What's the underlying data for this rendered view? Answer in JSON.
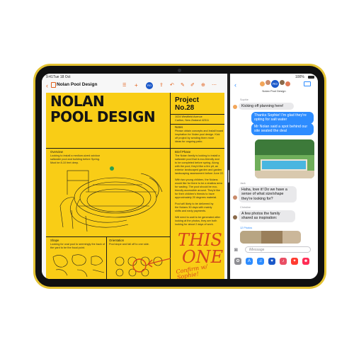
{
  "left_status": {
    "time": "9:41",
    "date": "Tue 18 Oct"
  },
  "right_status": {
    "battery": "100%"
  },
  "pages": {
    "doc_title": "Nolan Pool Design",
    "back_icon": "chevron-left-icon",
    "toolbar_icons": [
      "list-icon",
      "add-icon",
      "collaborate-icon",
      "share-icon",
      "undo-icon",
      "format-brush-icon",
      "more-icon"
    ]
  },
  "poster": {
    "title_lines": [
      "NOLAN",
      "POOL DESIGN"
    ],
    "project_lines": [
      "Project",
      "No.28"
    ],
    "address_lines": [
      "1024 Westfield Avenue",
      "Carlton, New Zealand 42311"
    ],
    "notes_label": "Notes",
    "notes_text": [
      "Please obtain concepts and install board",
      "inspiration for Nolan pool design. Kick",
      "off project by sending them more",
      "ideas for ongoing patio."
    ],
    "overview_label": "Overview",
    "overview_text": [
      "Looking to install a medium-sized outdoor",
      "saltwater pool and building before Spring.",
      "Must be 8-10 feet deep."
    ],
    "brief_label": "Brief Phase",
    "brief_text": [
      "The Nolan family is looking to install a",
      "saltwater pool that is eco-friendly and",
      "to be completed before spring. Along",
      "with the pool, they'd like a fire pit, an",
      "exterior landscaped garden and garden",
      "landscaping assessment before June 22."
    ],
    "brief_text2": [
      "With two young children, the Nolans",
      "would like for there to be a shallow area",
      "for wading. The pool should be eco-",
      "friendly accessible around. They'd like",
      "for their children's friends to have",
      "approximately 20 degrees material."
    ],
    "brief_text3": [
      "Pool will likely to be delivered by",
      "the Nolans 30 days with mainly",
      "shifts and early payments."
    ],
    "brief_text4": [
      "Will need to wait to be generated after",
      "looking at the photos, they are both",
      "looking for about 2 days of work."
    ],
    "shape_label": "Shape",
    "shape_text": [
      "Looking for oval pool to seemingly the back of",
      "the yard to be the focal point."
    ],
    "orientation_label": "Orientation",
    "orientation_text": [
      "Pool slope and fall off to one side."
    ],
    "handwriting_main": [
      "THIS",
      "ONE?"
    ],
    "handwriting_small": "Confirm w/ Sophie!"
  },
  "messages": {
    "group_name": "Nolan Pool Design",
    "group_icon": "group-avatar-icon",
    "video_icon": "video-call-icon",
    "thread": [
      {
        "sender": "Sophie",
        "direction": "in",
        "text": "Kicking off planning here!"
      },
      {
        "sender": "",
        "direction": "out",
        "text": "Thanks Sophie! I'm glad they're opting for salt water"
      },
      {
        "sender": "",
        "direction": "out",
        "text": "Mr Nolan said a spot behind our site seated the deal"
      },
      {
        "sender": "Jack",
        "direction": "in",
        "text": "Haha, love it! Do we have a sense of what size/shape they're looking for?"
      },
      {
        "sender": "Christine",
        "direction": "in",
        "text": "A few photos the family shared as inspiration:"
      }
    ],
    "photos_label": "12 Photos",
    "compose_placeholder": "iMessage",
    "camera_icon": "camera-icon",
    "apps_icon": "app-store-icon"
  },
  "colors": {
    "accent": "#e1601c",
    "poster": "#f9cd16",
    "blue": "#2d8cff",
    "handwriting": "#d5451b",
    "casing": "#e3c233"
  }
}
